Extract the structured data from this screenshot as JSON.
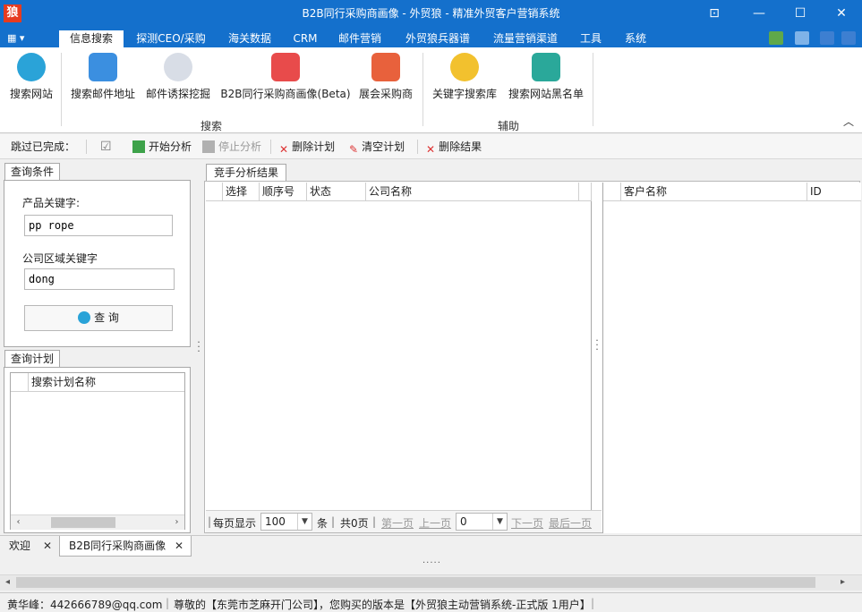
{
  "window": {
    "title": "B2B同行采购商画像 - 外贸狼 - 精准外贸客户营销系统",
    "logo_char": "狼",
    "controls": {
      "pin": "⊡",
      "minimize": "—",
      "maximize": "☐",
      "close": "✕"
    }
  },
  "menu": {
    "app_button": "▦ ▾",
    "tabs": [
      "信息搜索",
      "探测CEO/采购",
      "海关数据",
      "CRM",
      "邮件营销",
      "外贸狼兵器谱",
      "流量营销渠道",
      "工具",
      "系统"
    ]
  },
  "ribbon": {
    "buttons": [
      {
        "label": "搜索网站",
        "icon": "globe-search-icon",
        "color": "#2aa3d8"
      },
      {
        "label": "搜索邮件地址",
        "icon": "email-at-icon",
        "color": "#3b8fe0"
      },
      {
        "label": "邮件诱探挖掘",
        "icon": "email-probe-icon",
        "color": "#d8dde6"
      },
      {
        "label": "B2B同行采购商画像(Beta)",
        "icon": "puzzle-icon",
        "color": "#e84b4b"
      },
      {
        "label": "展会采购商",
        "icon": "magnifier-icon",
        "color": "#e8613c"
      },
      {
        "label": "关键字搜索库",
        "icon": "shopping-bag-icon",
        "color": "#f2c12e"
      },
      {
        "label": "搜索网站黑名单",
        "icon": "checklist-icon",
        "color": "#2aa89a"
      }
    ],
    "groups": [
      "搜索",
      "辅助"
    ],
    "collapse_glyph": "︿"
  },
  "toolbar": {
    "skip_label": "跳过已完成：",
    "checkbox_glyph": "☑",
    "items": [
      "开始分析",
      "停止分析",
      "删除计划",
      "清空计划",
      "删除结果"
    ]
  },
  "query": {
    "tab": "查询条件",
    "product_label": "产品关键字:",
    "product_value": "pp rope",
    "region_label": "公司区域关键字",
    "region_value": "dong",
    "search_button": "查  询"
  },
  "plan": {
    "tab": "查询计划",
    "column": "搜索计划名称"
  },
  "results": {
    "tab": "竞手分析结果",
    "columns": [
      "选择",
      "顺序号",
      "状态",
      "公司名称"
    ],
    "customer_columns": [
      "客户名称",
      "ID"
    ]
  },
  "pager": {
    "per_page_label": "每页显示",
    "per_page_value": "100",
    "unit": "条",
    "total": "共0页",
    "first": "第一页",
    "prev": "上一页",
    "page_value": "0",
    "next": "下一页",
    "last": "最后一页"
  },
  "doc_tabs": [
    "欢迎",
    "B2B同行采购商画像"
  ],
  "status": {
    "contact": "黄华峰：442666789@qq.com",
    "message": "尊敬的【东莞市芝麻开门公司】，您购买的版本是【外贸狼主动营销系统-正式版 1用户】"
  }
}
